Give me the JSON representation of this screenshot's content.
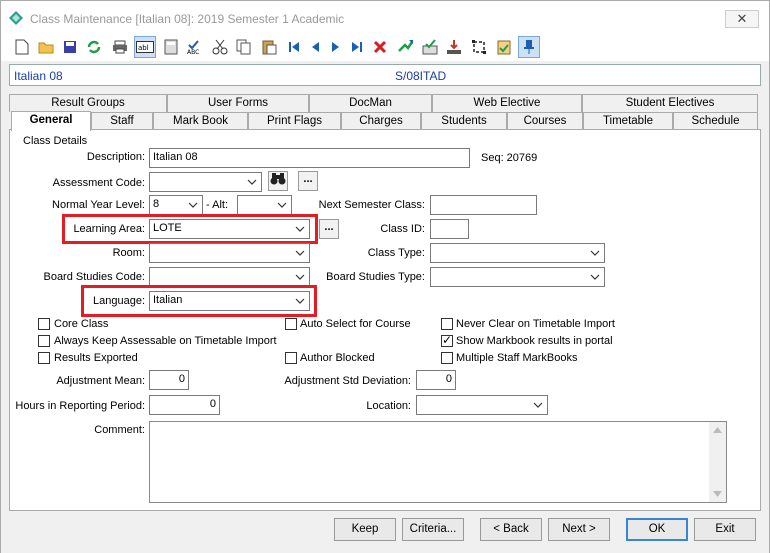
{
  "window": {
    "title": "Class Maintenance  [Italian 08]:  2019 Semester 1 Academic",
    "close_label": "✕"
  },
  "header": {
    "class_name": "Italian 08",
    "class_code": "S/08ITAD"
  },
  "toolbar": {
    "icons": [
      "new-icon",
      "open-icon",
      "save-icon",
      "refresh-icon",
      "print-icon",
      "text-field-icon",
      "calculator-icon",
      "spellcheck-icon",
      "cut-icon",
      "copy-icon",
      "paste-icon",
      "first-record-icon",
      "previous-record-icon",
      "next-record-icon",
      "last-record-icon",
      "delete-icon",
      "jump-icon",
      "approve-icon",
      "export-icon",
      "crop-icon",
      "clipboard-check-icon",
      "pin-icon"
    ]
  },
  "tabs": {
    "top_row": [
      "Result Groups",
      "User Forms",
      "DocMan",
      "Web Elective",
      "Student Electives"
    ],
    "bottom_row": [
      "General",
      "Staff",
      "Mark Book",
      "Print Flags",
      "Charges",
      "Students",
      "Courses",
      "Timetable",
      "Schedule"
    ],
    "selected": "General"
  },
  "form": {
    "group_label": "Class Details",
    "description_label": "Description:",
    "description_value": "Italian 08",
    "seq_label": "Seq: 20769",
    "assessment_code_label": "Assessment Code:",
    "assessment_code_value": "",
    "normal_year_level_label": "Normal Year Level:",
    "normal_year_level_value": "8",
    "alt_label": "-  Alt:",
    "alt_value": "",
    "next_semester_class_label": "Next Semester Class:",
    "next_semester_class_value": "",
    "learning_area_label": "Learning Area:",
    "learning_area_value": "LOTE",
    "class_id_label": "Class ID:",
    "class_id_value": "",
    "room_label": "Room:",
    "room_value": "",
    "class_type_label": "Class Type:",
    "class_type_value": "",
    "board_studies_code_label": "Board Studies Code:",
    "board_studies_code_value": "",
    "board_studies_type_label": "Board Studies Type:",
    "board_studies_type_value": "",
    "language_label": "Language:",
    "language_value": "Italian",
    "ellipsis": "...",
    "checkboxes": {
      "core_class": {
        "label": "Core Class",
        "checked": false
      },
      "auto_select_course": {
        "label": "Auto Select for Course",
        "checked": false
      },
      "never_clear": {
        "label": "Never Clear on Timetable Import",
        "checked": false
      },
      "always_keep_assessable": {
        "label": "Always Keep Assessable on Timetable Import",
        "checked": false
      },
      "show_markbook": {
        "label": "Show Markbook results in portal",
        "checked": true
      },
      "results_exported": {
        "label": "Results Exported",
        "checked": false
      },
      "author_blocked": {
        "label": "Author Blocked",
        "checked": false
      },
      "multiple_staff_markbooks": {
        "label": "Multiple Staff MarkBooks",
        "checked": false
      }
    },
    "adjustment_mean_label": "Adjustment Mean:",
    "adjustment_mean_value": "0",
    "adjustment_std_label": "Adjustment Std Deviation:",
    "adjustment_std_value": "0",
    "hours_label": "Hours in Reporting Period:",
    "hours_value": "0",
    "location_label": "Location:",
    "location_value": "",
    "comment_label": "Comment:",
    "comment_value": ""
  },
  "footer": {
    "keep": "Keep",
    "criteria": "Criteria...",
    "back": "< Back",
    "next": "Next >",
    "ok": "OK",
    "exit": "Exit"
  },
  "highlight_color": "#e31d24"
}
